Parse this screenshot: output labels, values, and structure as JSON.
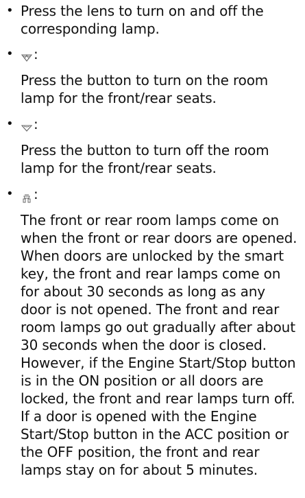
{
  "items": [
    {
      "text": "Press the lens to turn on and off the corresponding lamp."
    },
    {
      "icon": "room-lamp-on-icon",
      "colon": ":",
      "description": "Press the button to turn on the room lamp for the front/rear seats."
    },
    {
      "icon": "room-lamp-off-icon",
      "colon": ":",
      "description": "Press the button to turn off the room lamp for the front/rear seats."
    },
    {
      "icon": "door-lamp-icon",
      "colon": ":",
      "description": "The front or rear room lamps come on when the front or rear doors are opened. When doors are unlocked by the smart key, the front and rear lamps come on for about 30 seconds as long as any door is not opened. The front and rear room lamps go out gradually after about 30 seconds when the door is closed. However, if the Engine Start/Stop button is in the ON position or all doors are locked, the front and rear lamps turn off. If a door is opened with the Engine Start/Stop button in the ACC position or the OFF position, the front and rear lamps stay on for about 5 minutes."
    }
  ]
}
